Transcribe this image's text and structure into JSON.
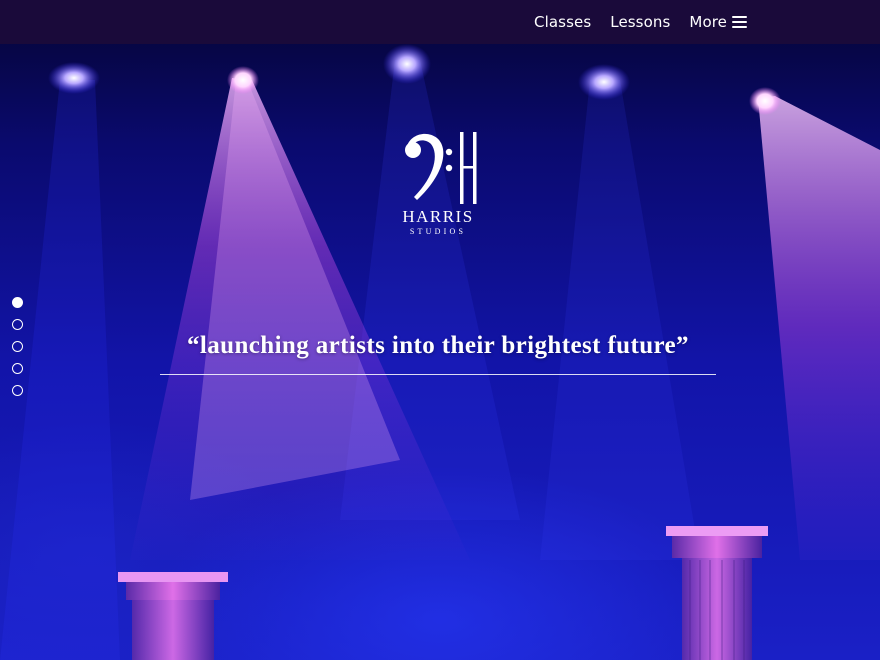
{
  "nav": {
    "links": [
      "Classes",
      "Lessons"
    ],
    "more_label": "More",
    "more_icon": "hamburger-menu-icon"
  },
  "logo": {
    "name": "HARRIS",
    "subtitle": "STUDIOS",
    "icon": "bass-clef-icon"
  },
  "hero": {
    "tagline": "“launching artists into their brightest future”",
    "slide_count": 5,
    "active_slide": 1
  },
  "colors": {
    "nav_background": "#1a0a3a",
    "stage_blue": "#1214a8",
    "spotlight_magenta": "#d24cf0",
    "text": "#ffffff"
  }
}
